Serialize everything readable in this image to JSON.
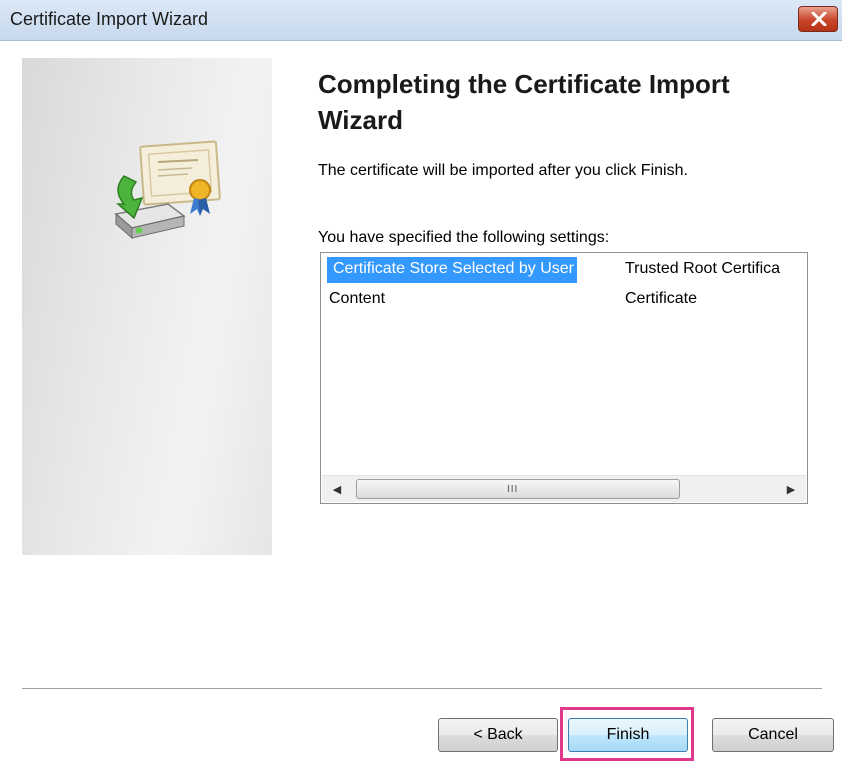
{
  "window": {
    "title": "Certificate Import Wizard"
  },
  "content": {
    "heading": "Completing the Certificate Import Wizard",
    "intro": "The certificate will be imported after you click Finish.",
    "settings_label": "You have specified the following settings:",
    "settings": [
      {
        "name": "Certificate Store Selected by User",
        "value": "Trusted Root Certifica",
        "selected": true
      },
      {
        "name": "Content",
        "value": "Certificate",
        "selected": false
      }
    ],
    "scroll_grip": "III"
  },
  "buttons": {
    "back": "< Back",
    "finish": "Finish",
    "cancel": "Cancel"
  },
  "colors": {
    "selection": "#3399ff",
    "highlight": "#e0388a"
  },
  "icons": {
    "close": "close-icon",
    "wizard": "certificate-import-icon",
    "scroll_left": "scroll-left-arrow-icon",
    "scroll_right": "scroll-right-arrow-icon"
  }
}
